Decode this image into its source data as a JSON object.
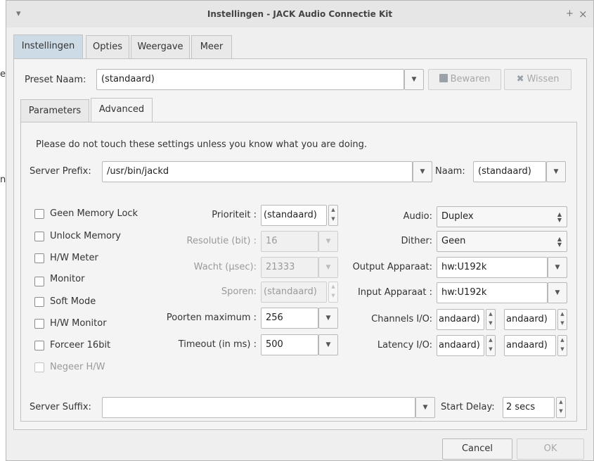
{
  "window": {
    "title": "Instellingen - JACK Audio Connectie Kit",
    "menu_glyph": "▾",
    "pin_glyph": "+",
    "close_glyph": "×"
  },
  "top_tabs": [
    "Instellingen",
    "Opties",
    "Weergave",
    "Meer"
  ],
  "preset": {
    "label": "Preset Naam:",
    "value": "(standaard)",
    "save_label": "Bewaren",
    "delete_label": "Wissen"
  },
  "sub_tabs": [
    "Parameters",
    "Advanced"
  ],
  "advanced": {
    "warning": "Please do not touch these settings unless you know what you are doing.",
    "server_prefix_label": "Server Prefix:",
    "server_prefix_value": "/usr/bin/jackd",
    "name_label": "Naam:",
    "name_value": "(standaard)",
    "checkboxes": [
      {
        "label": "Geen Memory Lock",
        "checked": false,
        "disabled": false
      },
      {
        "label": "Unlock Memory",
        "checked": false,
        "disabled": false
      },
      {
        "label": "H/W Meter",
        "checked": false,
        "disabled": false
      },
      {
        "label": "Monitor",
        "checked": false,
        "disabled": false
      },
      {
        "label": "Soft Mode",
        "checked": false,
        "disabled": false
      },
      {
        "label": "H/W Monitor",
        "checked": false,
        "disabled": false
      },
      {
        "label": "Forceer 16bit",
        "checked": false,
        "disabled": false
      },
      {
        "label": "Negeer H/W",
        "checked": false,
        "disabled": true
      }
    ],
    "mid_fields": [
      {
        "label": "Prioriteit :",
        "value": "(standaard)",
        "kind": "spin",
        "disabled": false
      },
      {
        "label": "Resolutie (bit) :",
        "value": "16",
        "kind": "combo",
        "disabled": true
      },
      {
        "label": "Wacht (µsec):",
        "value": "21333",
        "kind": "combo",
        "disabled": true
      },
      {
        "label": "Sporen:",
        "value": "(standaard)",
        "kind": "spin",
        "disabled": true
      },
      {
        "label": "Poorten maximum :",
        "value": "256",
        "kind": "combo",
        "disabled": false
      },
      {
        "label": "Timeout (in ms) :",
        "value": "500",
        "kind": "combo",
        "disabled": false
      }
    ],
    "audio_label": "Audio:",
    "audio_value": "Duplex",
    "dither_label": "Dither:",
    "dither_value": "Geen",
    "output_label": "Output Apparaat:",
    "output_value": "hw:U192k",
    "input_label": "Input Apparaat :",
    "input_value": "hw:U192k",
    "channels_label": "Channels I/O:",
    "channels_in": "andaard)",
    "channels_out": "andaard)",
    "latency_label": "Latency I/O:",
    "latency_in": "andaard)",
    "latency_out": "andaard)",
    "server_suffix_label": "Server Suffix:",
    "server_suffix_value": "",
    "start_delay_label": "Start Delay:",
    "start_delay_value": "2 secs"
  },
  "footer": {
    "cancel_label": "Cancel",
    "ok_label": "OK"
  },
  "background_fragments": [
    "e",
    "n"
  ]
}
